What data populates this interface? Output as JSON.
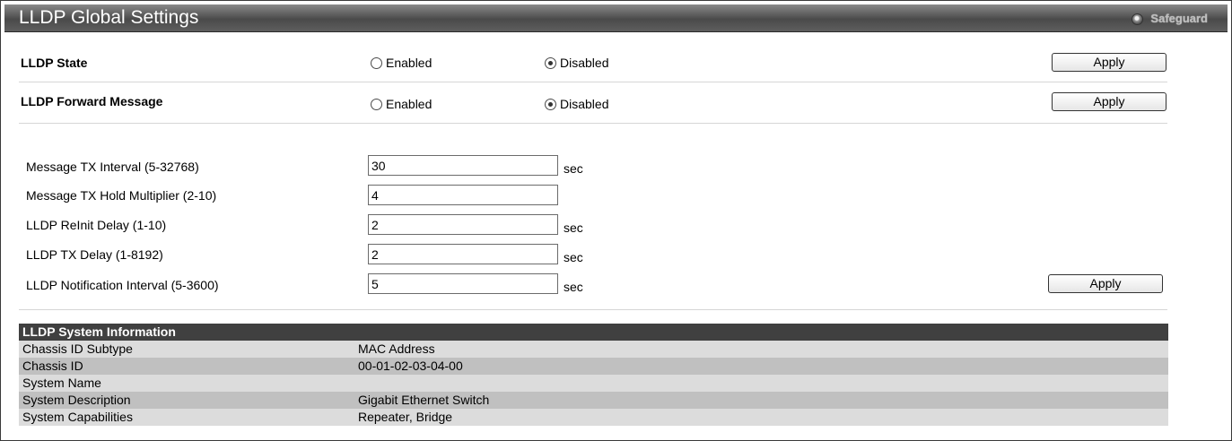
{
  "header": {
    "title": "LLDP Global Settings",
    "safeguard_label": "Safeguard"
  },
  "lldp_state": {
    "label": "LLDP State",
    "options": [
      "Enabled",
      "Disabled"
    ],
    "selected": "Disabled",
    "apply_label": "Apply"
  },
  "forward_message": {
    "label": "LLDP Forward Message",
    "options": [
      "Enabled",
      "Disabled"
    ],
    "selected": "Disabled",
    "apply_label": "Apply"
  },
  "params": {
    "tx_interval": {
      "label": "Message TX Interval (5-32768)",
      "value": "30",
      "unit": "sec"
    },
    "hold_multiplier": {
      "label": "Message TX Hold Multiplier (2-10)",
      "value": "4",
      "unit": ""
    },
    "reinit_delay": {
      "label": "LLDP ReInit Delay (1-10)",
      "value": "2",
      "unit": "sec"
    },
    "tx_delay": {
      "label": "LLDP TX Delay (1-8192)",
      "value": "2",
      "unit": "sec"
    },
    "notification_interval": {
      "label": "LLDP Notification Interval (5-3600)",
      "value": "5",
      "unit": "sec"
    },
    "apply_label": "Apply"
  },
  "system_info": {
    "title": "LLDP System Information",
    "rows": [
      {
        "key": "Chassis ID Subtype",
        "value": "MAC Address"
      },
      {
        "key": "Chassis ID",
        "value": "00-01-02-03-04-00"
      },
      {
        "key": "System Name",
        "value": ""
      },
      {
        "key": "System Description",
        "value": "Gigabit Ethernet Switch"
      },
      {
        "key": "System Capabilities",
        "value": "Repeater, Bridge"
      }
    ]
  },
  "colors": {
    "title_bar": "#5e5e5e",
    "table_header": "#404040",
    "row_light": "#dcdcdc",
    "row_dark": "#c0c0c0"
  }
}
